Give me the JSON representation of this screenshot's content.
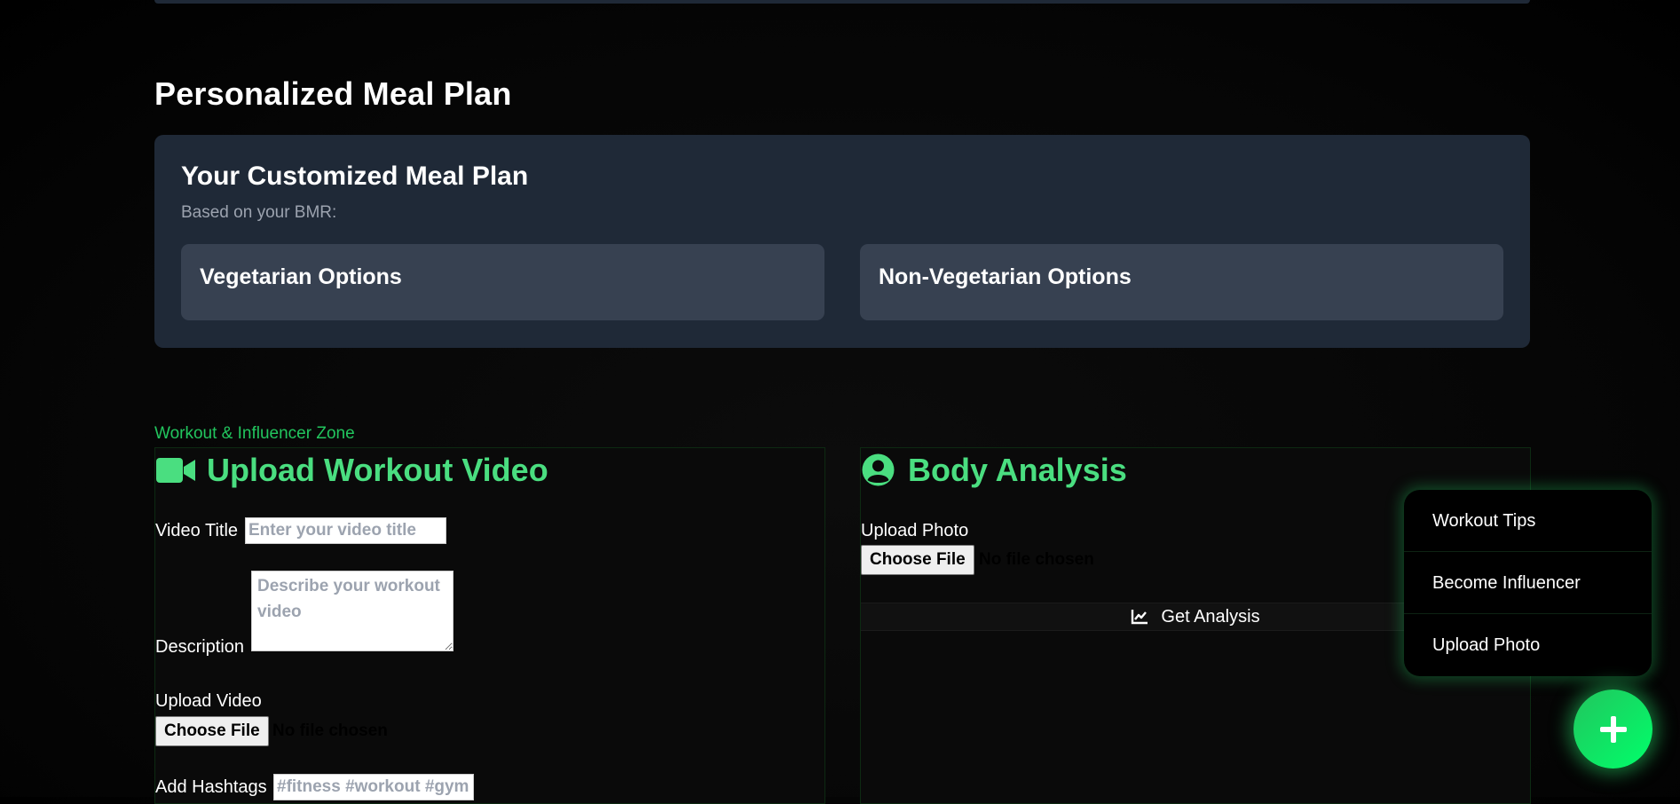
{
  "meal": {
    "section_title": "Personalized Meal Plan",
    "card_title": "Your Customized Meal Plan",
    "subtitle": "Based on your BMR:",
    "veg_label": "Vegetarian Options",
    "nonveg_label": "Non-Vegetarian Options"
  },
  "zone": {
    "label": "Workout & Influencer Zone"
  },
  "upload": {
    "title": "Upload Workout Video",
    "icon": "video-camera-icon",
    "video_title_label": "Video Title",
    "video_title_placeholder": "Enter your video title",
    "description_label": "Description",
    "description_placeholder": "Describe your workout video",
    "upload_video_label": "Upload Video",
    "choose_file": "Choose File",
    "no_file": "No file chosen",
    "hashtags_label": "Add Hashtags",
    "hashtags_placeholder": "#fitness #workout #gym"
  },
  "body": {
    "title": "Body Analysis",
    "icon": "user-circle-icon",
    "upload_photo_label": "Upload Photo",
    "choose_file": "Choose File",
    "no_file": "No file chosen",
    "analysis_button": "Get Analysis",
    "analysis_icon": "chart-line-icon"
  },
  "menu": {
    "items": [
      {
        "label": "Workout Tips"
      },
      {
        "label": "Become Influencer"
      },
      {
        "label": "Upload Photo"
      }
    ]
  },
  "fab": {
    "icon": "plus-icon"
  },
  "colors": {
    "accent_green": "#4ade80",
    "zone_green": "#22c55e",
    "card_bg": "#1f2937",
    "option_bg": "#374151"
  }
}
